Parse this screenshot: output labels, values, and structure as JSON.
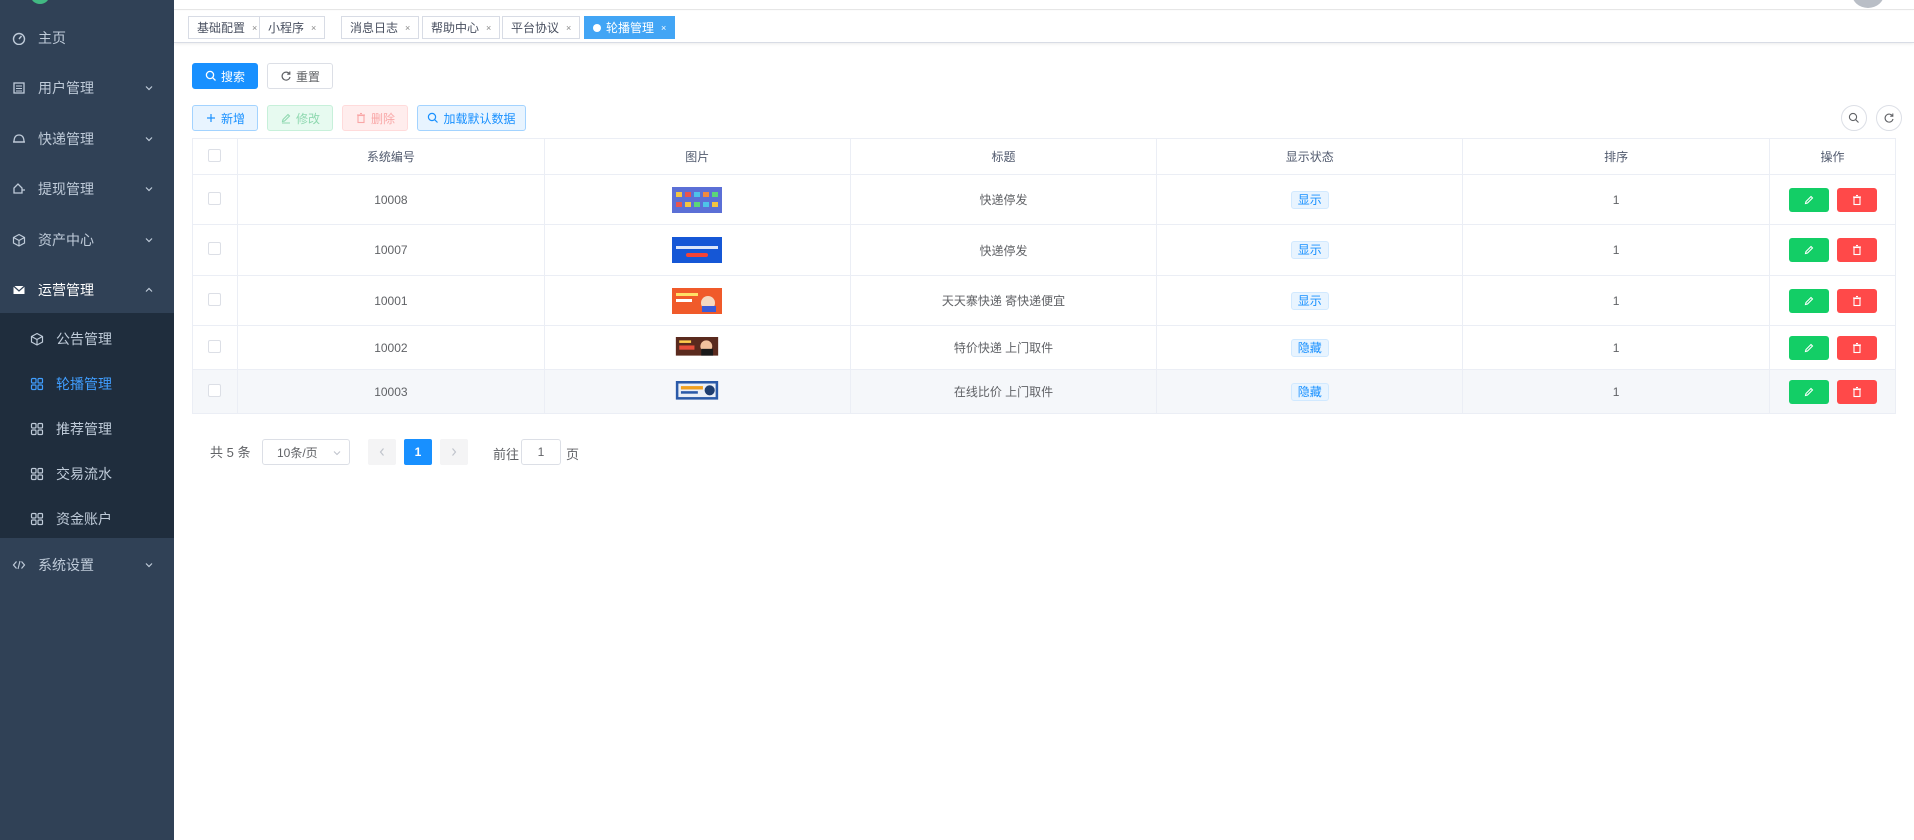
{
  "sidebar": {
    "items": [
      {
        "label": "主页",
        "icon": "dashboard-icon"
      },
      {
        "label": "用户管理",
        "icon": "list-icon"
      },
      {
        "label": "快递管理",
        "icon": "delivery-icon"
      },
      {
        "label": "提现管理",
        "icon": "withdraw-icon"
      },
      {
        "label": "资产中心",
        "icon": "cube-icon"
      },
      {
        "label": "运营管理",
        "icon": "mail-icon"
      },
      {
        "label": "系统设置",
        "icon": "code-icon"
      }
    ],
    "subitems": [
      {
        "label": "公告管理",
        "icon": "cube-icon"
      },
      {
        "label": "轮播管理",
        "icon": "grid-icon"
      },
      {
        "label": "推荐管理",
        "icon": "grid-icon"
      },
      {
        "label": "交易流水",
        "icon": "grid-icon"
      },
      {
        "label": "资金账户",
        "icon": "grid-icon"
      }
    ]
  },
  "tags": [
    "基础配置",
    "小程序",
    "消息日志",
    "帮助中心",
    "平台协议",
    "轮播管理"
  ],
  "toolbar": {
    "search_label": "搜索",
    "reset_label": "重置",
    "add_label": "新增",
    "edit_label": "修改",
    "delete_label": "删除",
    "load_default_label": "加载默认数据"
  },
  "table": {
    "headers": [
      "系统编号",
      "图片",
      "标题",
      "显示状态",
      "排序",
      "操作"
    ],
    "rows": [
      {
        "id": "10008",
        "title": "快递停发",
        "status": "显示",
        "sort": "1",
        "thumb": "#5b6fd6"
      },
      {
        "id": "10007",
        "title": "快递停发",
        "status": "显示",
        "sort": "1",
        "thumb": "#1557d6"
      },
      {
        "id": "10001",
        "title": "天天寨快递 寄快递便宜",
        "status": "显示",
        "sort": "1",
        "thumb": "#f05a2a"
      },
      {
        "id": "10002",
        "title": "特价快递 上门取件",
        "status": "隐藏",
        "sort": "1",
        "thumb": "#5a2a1e"
      },
      {
        "id": "10003",
        "title": "在线比价 上门取件",
        "status": "隐藏",
        "sort": "1",
        "thumb": "#2a5aa8"
      }
    ]
  },
  "pagination": {
    "total_text": "共 5 条",
    "page_size": "10条/页",
    "current_page": "1",
    "goto_label": "前往",
    "goto_value": "1",
    "page_suffix": "页"
  },
  "colors": {
    "sidebar_bg": "#304156",
    "submenu_bg": "#1f2d3d",
    "primary": "#1890ff",
    "success": "#13ce66",
    "danger": "#ff4949"
  }
}
